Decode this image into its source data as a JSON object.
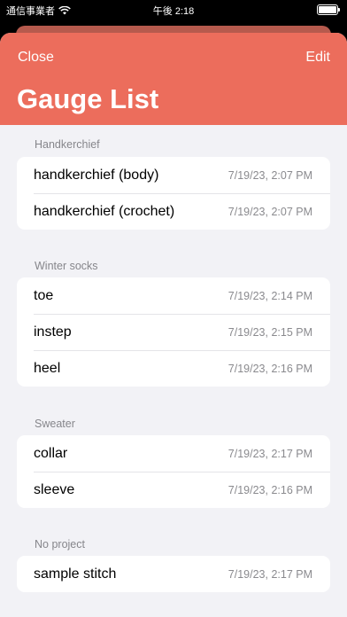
{
  "status_bar": {
    "carrier": "通信事業者",
    "time": "午後 2:18",
    "battery_level": 1.0
  },
  "nav": {
    "close_label": "Close",
    "edit_label": "Edit",
    "title": "Gauge List"
  },
  "colors": {
    "header": "#ec6d5c",
    "background": "#f2f2f6"
  },
  "sections": [
    {
      "label": "Handkerchief",
      "items": [
        {
          "name": "handkerchief (body)",
          "date": "7/19/23, 2:07 PM"
        },
        {
          "name": "handkerchief (crochet)",
          "date": "7/19/23, 2:07 PM"
        }
      ]
    },
    {
      "label": "Winter socks",
      "items": [
        {
          "name": "toe",
          "date": "7/19/23, 2:14 PM"
        },
        {
          "name": "instep",
          "date": "7/19/23, 2:15 PM"
        },
        {
          "name": "heel",
          "date": "7/19/23, 2:16 PM"
        }
      ]
    },
    {
      "label": "Sweater",
      "items": [
        {
          "name": "collar",
          "date": "7/19/23, 2:17 PM"
        },
        {
          "name": "sleeve",
          "date": "7/19/23, 2:16 PM"
        }
      ]
    },
    {
      "label": "No project",
      "items": [
        {
          "name": "sample stitch",
          "date": "7/19/23, 2:17 PM"
        }
      ]
    }
  ]
}
